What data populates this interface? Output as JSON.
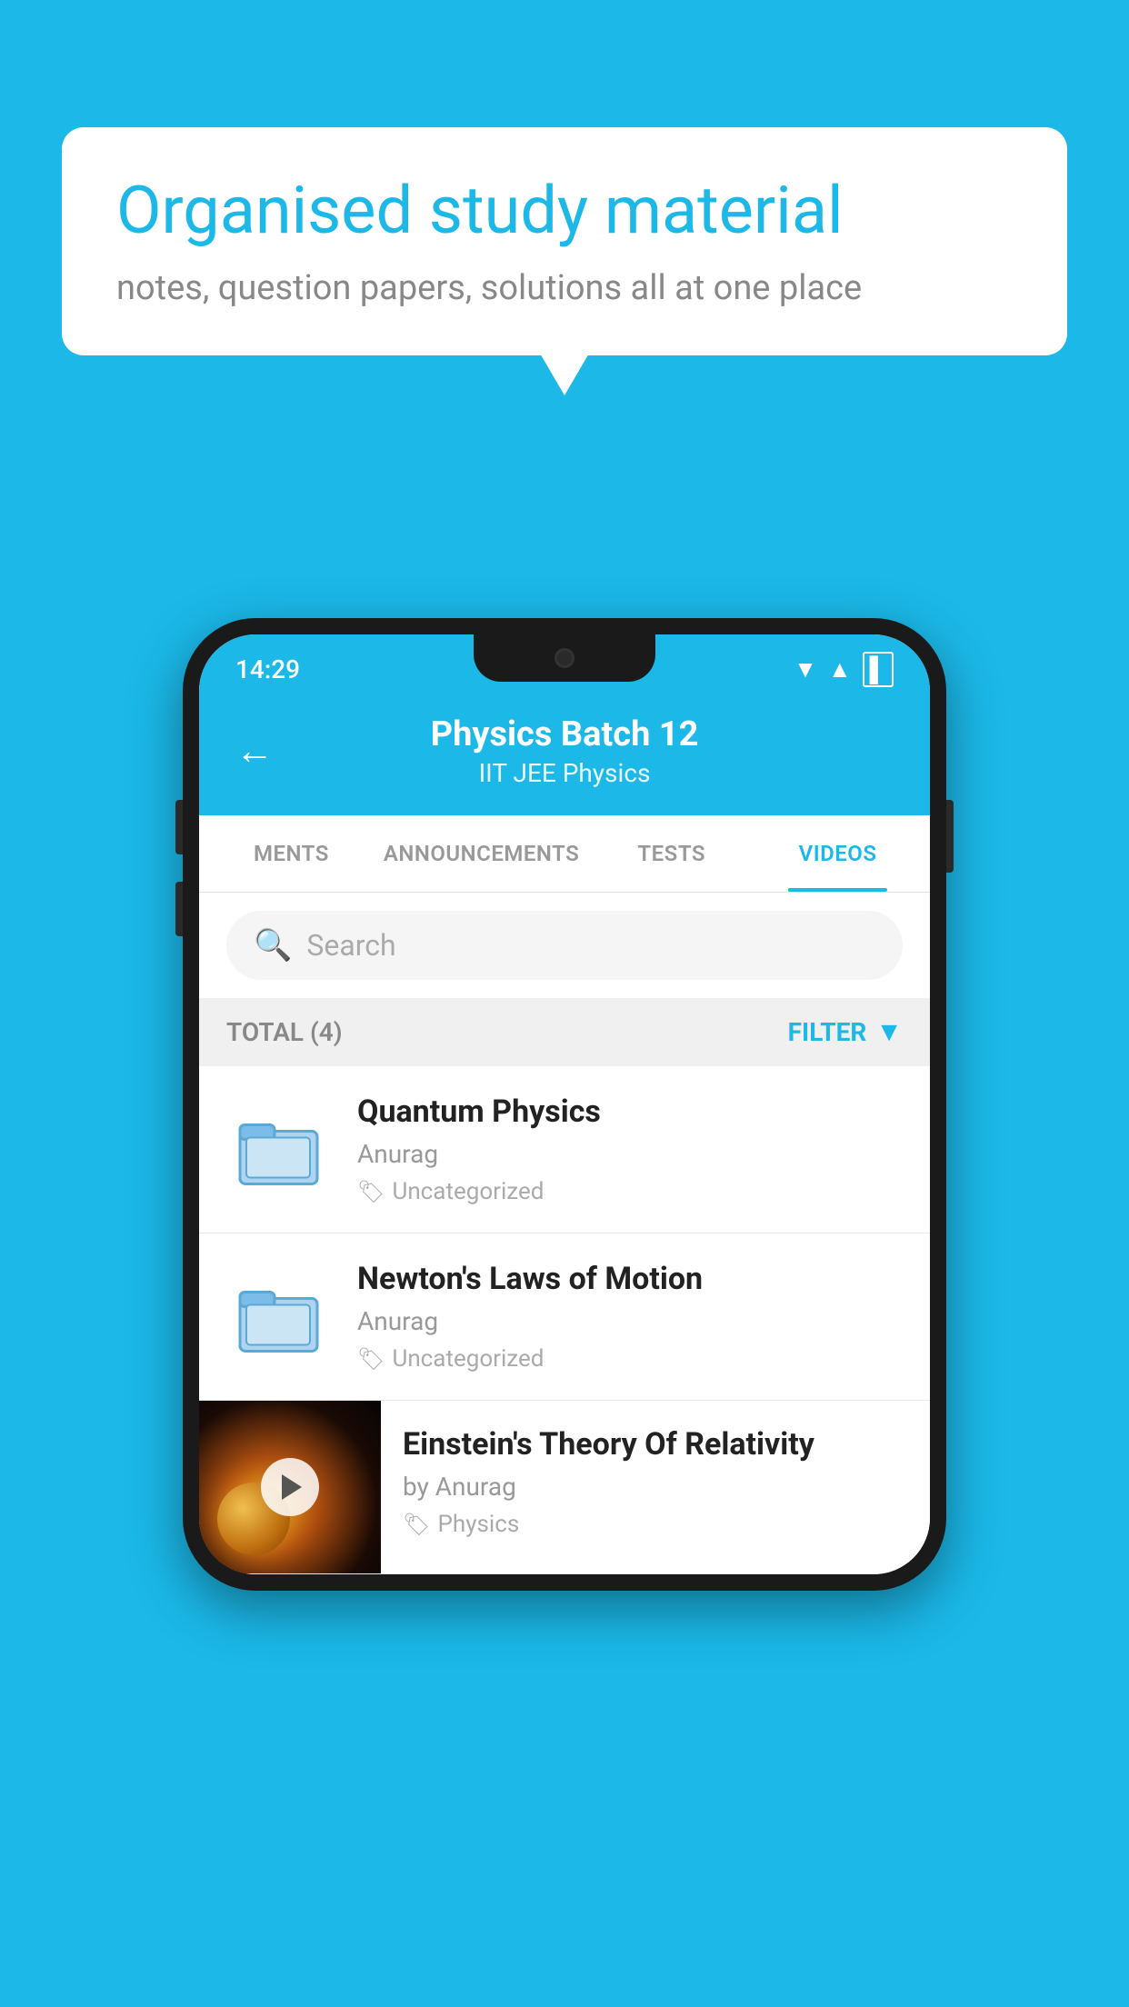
{
  "background": {
    "color": "#1bb8e8"
  },
  "speech_bubble": {
    "title": "Organised study material",
    "subtitle": "notes, question papers, solutions all at one place"
  },
  "status_bar": {
    "time": "14:29",
    "wifi": "▼",
    "signal": "▲",
    "battery": "▌"
  },
  "header": {
    "back_label": "←",
    "title": "Physics Batch 12",
    "subtitle": "IIT JEE   Physics"
  },
  "tabs": [
    {
      "label": "MENTS",
      "active": false
    },
    {
      "label": "ANNOUNCEMENTS",
      "active": false
    },
    {
      "label": "TESTS",
      "active": false
    },
    {
      "label": "VIDEOS",
      "active": true
    }
  ],
  "search": {
    "placeholder": "Search"
  },
  "filter_bar": {
    "total_label": "TOTAL (4)",
    "filter_label": "FILTER"
  },
  "videos": [
    {
      "title": "Quantum Physics",
      "author": "Anurag",
      "tag": "Uncategorized",
      "has_thumbnail": false
    },
    {
      "title": "Newton's Laws of Motion",
      "author": "Anurag",
      "tag": "Uncategorized",
      "has_thumbnail": false
    },
    {
      "title": "Einstein's Theory Of Relativity",
      "author": "by Anurag",
      "tag": "Physics",
      "has_thumbnail": true
    }
  ]
}
